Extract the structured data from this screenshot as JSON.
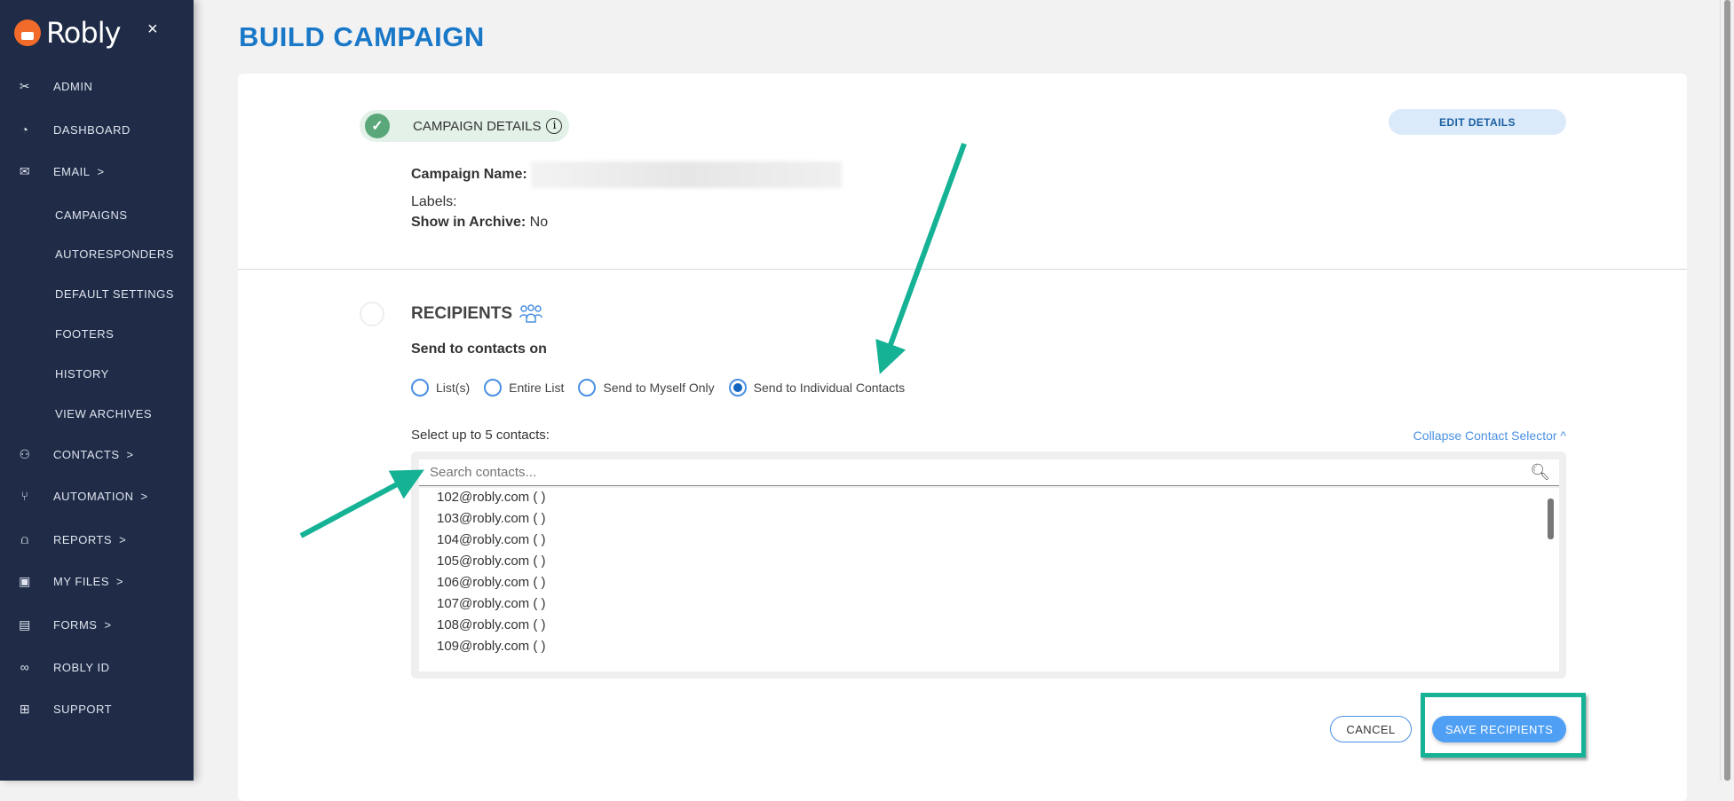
{
  "sidebar": {
    "brand": "Robly",
    "close": "×",
    "items": [
      {
        "label": "ADMIN",
        "icon": "✂",
        "chev": ""
      },
      {
        "label": "DASHBOARD",
        "icon": "◔",
        "chev": ""
      },
      {
        "label": "EMAIL",
        "icon": "✉",
        "chev": ">"
      },
      {
        "label": "CAMPAIGNS",
        "icon": "",
        "chev": ""
      },
      {
        "label": "AUTORESPONDERS",
        "icon": "",
        "chev": ""
      },
      {
        "label": "DEFAULT SETTINGS",
        "icon": "",
        "chev": ""
      },
      {
        "label": "FOOTERS",
        "icon": "",
        "chev": ""
      },
      {
        "label": "HISTORY",
        "icon": "",
        "chev": ""
      },
      {
        "label": "VIEW ARCHIVES",
        "icon": "",
        "chev": ""
      },
      {
        "label": "CONTACTS",
        "icon": "⚇",
        "chev": ">"
      },
      {
        "label": "AUTOMATION",
        "icon": "⑂",
        "chev": ">"
      },
      {
        "label": "REPORTS",
        "icon": "⩍",
        "chev": ">"
      },
      {
        "label": "MY FILES",
        "icon": "▣",
        "chev": ">"
      },
      {
        "label": "FORMS",
        "icon": "▤",
        "chev": ">"
      },
      {
        "label": "ROBLY ID",
        "icon": "∞",
        "chev": ""
      },
      {
        "label": "SUPPORT",
        "icon": "⊞",
        "chev": ""
      }
    ]
  },
  "page": {
    "title": "BUILD CAMPAIGN"
  },
  "details": {
    "step_label": "CAMPAIGN DETAILS",
    "info": "i",
    "edit": "EDIT DETAILS",
    "name_label": "Campaign Name:",
    "labels_label": "Labels:",
    "archive_label": "Show in Archive:",
    "archive_value": " No"
  },
  "recipients": {
    "title": "RECIPIENTS",
    "send_on": "Send to contacts on",
    "options": [
      {
        "label": "List(s)",
        "selected": false
      },
      {
        "label": "Entire List",
        "selected": false
      },
      {
        "label": "Send to Myself Only",
        "selected": false
      },
      {
        "label": "Send to Individual Contacts",
        "selected": true
      }
    ],
    "select_hint": "Select up to 5 contacts:",
    "collapse": "Collapse  Contact Selector ^",
    "search_placeholder": "Search contacts...",
    "search_value": "",
    "contacts": [
      "102@robly.com ( )",
      "103@robly.com ( )",
      "104@robly.com ( )",
      "105@robly.com ( )",
      "106@robly.com ( )",
      "107@robly.com ( )",
      "108@robly.com ( )",
      "109@robly.com ( )"
    ],
    "cancel": "CANCEL",
    "save": "SAVE RECIPIENTS"
  },
  "colors": {
    "sidebar": "#1f2b47",
    "accent": "#1978c8",
    "save": "#4fa0f5",
    "annotation": "#15b295"
  }
}
